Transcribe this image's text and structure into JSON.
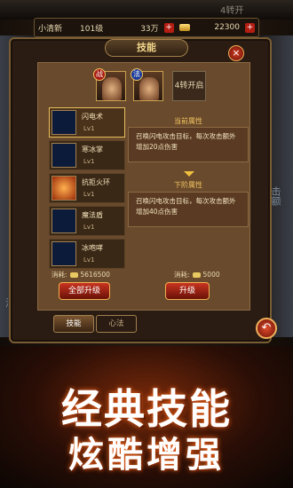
{
  "topbar": {
    "player_name": "小清新",
    "currency1": "101级",
    "currency2": "33万",
    "currency3": "22300",
    "label": "4转开"
  },
  "side": {
    "left_text": "消耗",
    "right_text": "击额"
  },
  "panel": {
    "title": "技能",
    "close": "×"
  },
  "classes": [
    {
      "badge": "战"
    },
    {
      "badge": "法"
    },
    {
      "label": "4转开启"
    }
  ],
  "skills": [
    {
      "name": "闪电术",
      "level": "Lv1"
    },
    {
      "name": "寒冰掌",
      "level": "Lv1"
    },
    {
      "name": "抗拒火环",
      "level": "Lv1"
    },
    {
      "name": "魔法盾",
      "level": "Lv1"
    },
    {
      "name": "冰咆哮",
      "level": "Lv1"
    }
  ],
  "current": {
    "title": "当前属性",
    "text": "召唤闪电攻击目标，每次攻击额外增加20点伤害"
  },
  "next": {
    "title": "下阶属性",
    "text": "召唤闪电攻击目标，每次攻击额外增加40点伤害"
  },
  "cost_all": {
    "label": "消耗:",
    "value": "5616500"
  },
  "cost_one": {
    "label": "消耗:",
    "value": "5000"
  },
  "buttons": {
    "upgrade_all": "全部升级",
    "upgrade": "升级"
  },
  "tabs": {
    "skill": "技能",
    "mind": "心法"
  },
  "promo": {
    "line1": "经典技能",
    "line2": "炫酷增强"
  },
  "colors": {
    "accent": "#f0c460",
    "button_red": "#c83420",
    "frame": "#7a5c34"
  }
}
